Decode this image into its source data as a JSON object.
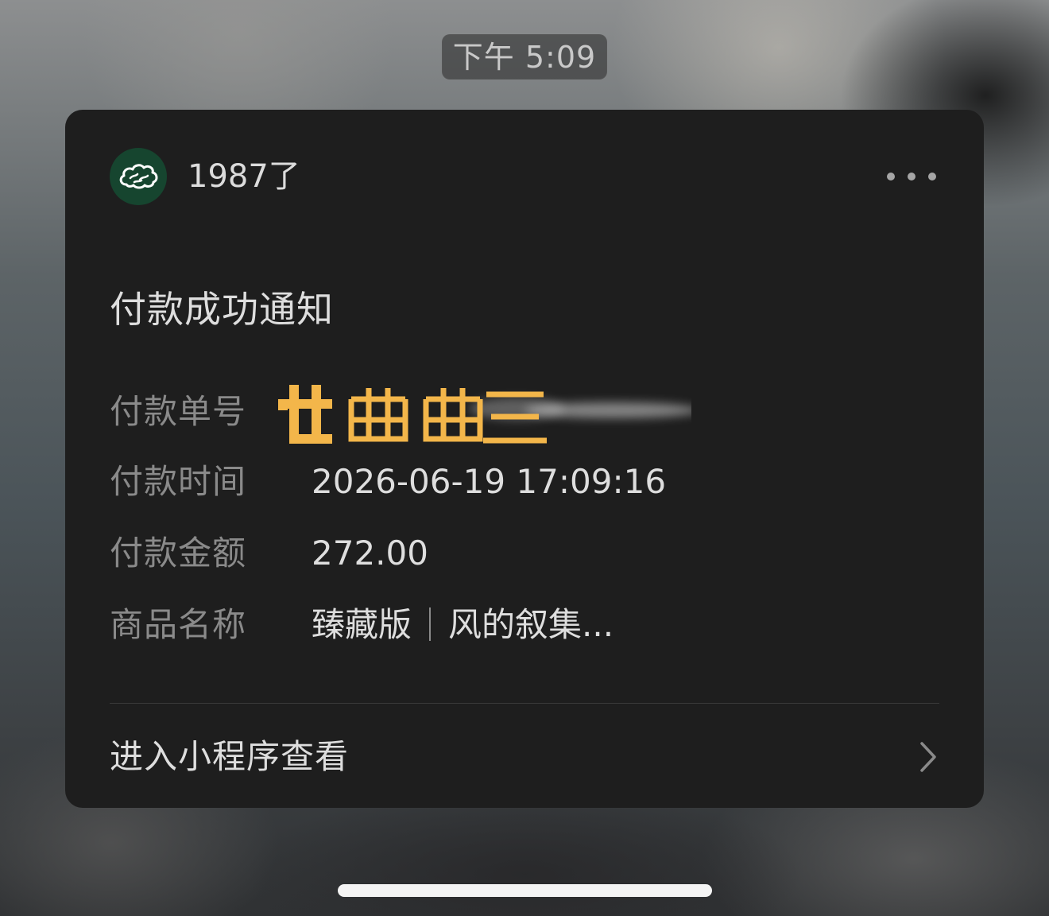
{
  "status_time": "下午 5:09",
  "card": {
    "account_name": "1987了",
    "avatar_icon": "cloud-logo-icon",
    "more_icon": "more-dots-icon",
    "title": "付款成功通知",
    "rows": [
      {
        "label": "付款单号",
        "value": ""
      },
      {
        "label": "付款时间",
        "value": "2026-06-19 17:09:16"
      },
      {
        "label": "付款金额",
        "value": "272.00"
      },
      {
        "label": "商品名称",
        "value_part1": "臻藏版",
        "value_part2": "风的叙集..."
      }
    ],
    "footer_link": "进入小程序查看",
    "chevron_icon": "chevron-right-icon"
  },
  "colors": {
    "card_bg": "#1e1e1e",
    "avatar_bg": "#16452f",
    "redaction": "#f3b64a"
  }
}
